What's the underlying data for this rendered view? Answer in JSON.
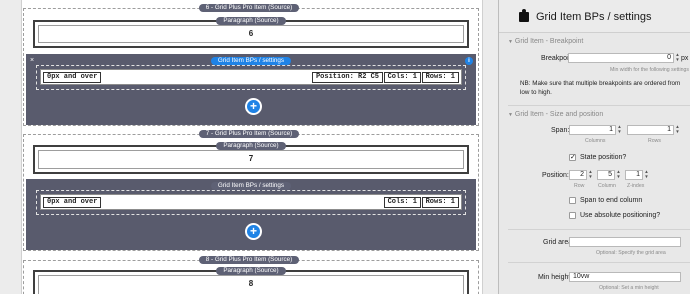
{
  "canvas": {
    "items": [
      {
        "tab": "6 - Grid Plus Pro Item (Source)",
        "paragraph_tab": "Paragraph (Source)",
        "paragraph_value": "6",
        "bp_tab": "Grid Item BPs / settings",
        "breakpoint": "0px and over",
        "position": "Position: R2 C5",
        "cols": "Cols: 1",
        "rows": "Rows: 1",
        "plus": "+"
      },
      {
        "tab": "7 - Grid Plus Pro Item (Source)",
        "paragraph_tab": "Paragraph (Source)",
        "paragraph_value": "7",
        "bp_tab": "Grid Item BPs / settings",
        "breakpoint": "0px and over",
        "cols": "Cols: 1",
        "rows": "Rows: 1",
        "plus": "+"
      },
      {
        "tab": "8 - Grid Plus Pro Item (Source)",
        "paragraph_tab": "Paragraph (Source)",
        "paragraph_value": "8"
      }
    ],
    "close_glyph": "×",
    "info_glyph": "i"
  },
  "panel": {
    "title": "Grid Item BPs / settings",
    "section_breakpoint": "Grid Item - Breakpoint",
    "breakpoint_label": "Breakpoint:",
    "breakpoint_value": "0",
    "breakpoint_unit": "px",
    "breakpoint_hint": "Min width for the following settings",
    "note": "NB: Make sure that multiple breakpoints are ordered from low to high.",
    "section_size": "Grid Item - Size and position",
    "span_label": "Span:",
    "span_columns": "1",
    "span_rows": "1",
    "columns_caption": "Columns",
    "rows_caption": "Rows",
    "state_position_label": "State position?",
    "state_position_checked": true,
    "position_label": "Position:",
    "pos_row": "2",
    "pos_column": "5",
    "pos_zindex": "1",
    "row_caption": "Row",
    "column_caption": "Column",
    "zindex_caption": "Z-index",
    "span_to_end_label": "Span to end column",
    "use_absolute_label": "Use absolute positioning?",
    "grid_area_label": "Grid area:",
    "grid_area_value": "",
    "grid_area_hint": "Optional: Specify the grid area",
    "min_height_label": "Min height:",
    "min_height_value": "10vw",
    "min_height_hint": "Optional: Set a min height",
    "stepper_up": "▲",
    "stepper_down": "▼",
    "disclosure": "▼"
  }
}
